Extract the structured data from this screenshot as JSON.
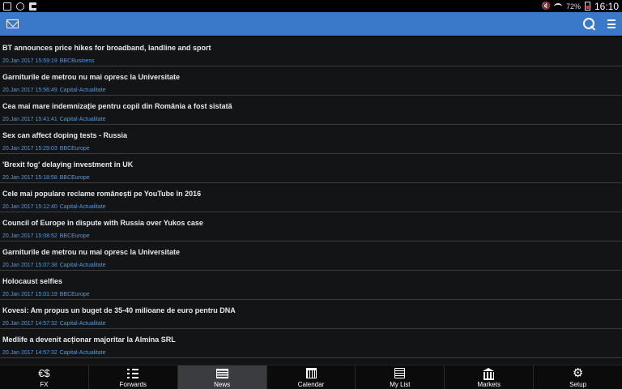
{
  "status_bar": {
    "battery": "72%",
    "time": "16:10"
  },
  "news": [
    {
      "title": "BT announces price hikes for broadband, landline and sport",
      "date": "20.Jan 2017 15:59:19",
      "source": "BBCBusiness"
    },
    {
      "title": "Garniturile de metrou nu mai opresc la Universitate",
      "date": "20.Jan 2017 15:56:49",
      "source": "Capital-Actualitate"
    },
    {
      "title": "Cea mai mare indemnizație pentru copil din România a fost sistată",
      "date": "20.Jan 2017 15:41:41",
      "source": "Capital-Actualitate"
    },
    {
      "title": "Sex can affect doping tests - Russia",
      "date": "20.Jan 2017 15:29:03",
      "source": "BBCEurope"
    },
    {
      "title": "'Brexit fog' delaying investment in UK",
      "date": "20.Jan 2017 15:18:58",
      "source": "BBCEurope"
    },
    {
      "title": "Cele mai populare reclame românești pe YouTube în 2016",
      "date": "20.Jan 2017 15:12:40",
      "source": "Capital-Actualitate"
    },
    {
      "title": "Council of Europe in dispute with Russia over Yukos case",
      "date": "20.Jan 2017 15:08:52",
      "source": "BBCEurope"
    },
    {
      "title": "Garniturile de metrou nu mai opresc la Universitate",
      "date": "20.Jan 2017 15:07:38",
      "source": "Capital-Actualitate"
    },
    {
      "title": "Holocaust selfies",
      "date": "20.Jan 2017 15:01:19",
      "source": "BBCEurope"
    },
    {
      "title": "Kovesi: Am propus un buget de 35-40 milioane de euro pentru DNA",
      "date": "20.Jan 2017 14:57:32",
      "source": "Capital-Actualitate"
    },
    {
      "title": "Medlife a devenit acționar majoritar la Almina SRL",
      "date": "20.Jan 2017 14:57:32",
      "source": "Capital-Actualitate"
    }
  ],
  "tabs": [
    {
      "id": "fx",
      "label": "FX",
      "icon": "euro-dollar-icon",
      "glyph": "€$"
    },
    {
      "id": "forwards",
      "label": "Forwards",
      "icon": "list-icon"
    },
    {
      "id": "news",
      "label": "News",
      "icon": "newspaper-icon",
      "active": true
    },
    {
      "id": "calendar",
      "label": "Calendar",
      "icon": "calendar-icon"
    },
    {
      "id": "mylist",
      "label": "My List",
      "icon": "my-list-icon"
    },
    {
      "id": "markets",
      "label": "Markets",
      "icon": "bank-icon"
    },
    {
      "id": "setup",
      "label": "Setup",
      "icon": "gear-icon"
    }
  ],
  "colors": {
    "app_bar": "#3a79c9",
    "list_background": "#131416",
    "meta_text": "#4f9be8",
    "active_tab": "#3a3c3f"
  }
}
